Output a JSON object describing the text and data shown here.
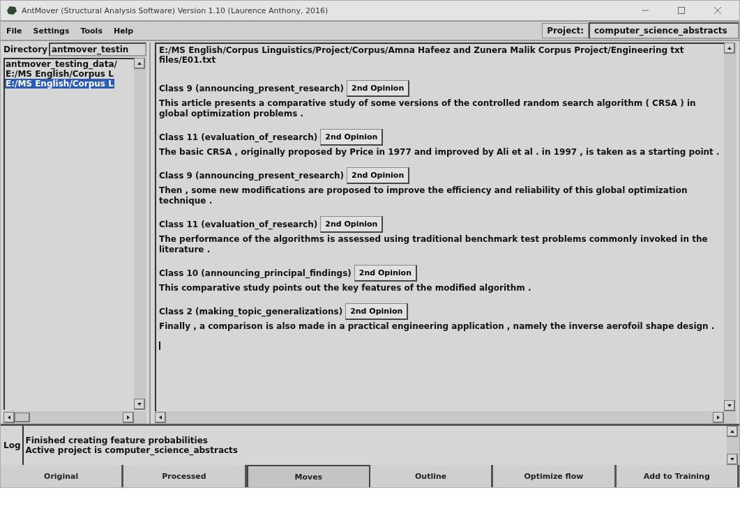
{
  "window": {
    "title": "AntMover (Structural Analysis Software) Version 1.10 (Laurence Anthony, 2016)"
  },
  "menu": [
    "File",
    "Settings",
    "Tools",
    "Help"
  ],
  "project": {
    "label": "Project:",
    "value": "computer_science_abstracts"
  },
  "directory": {
    "label": "Directory",
    "value": "antmover_testin"
  },
  "files": [
    {
      "label": "antmover_testing_data/",
      "selected": false
    },
    {
      "label": "E:/MS English/Corpus L",
      "selected": false
    },
    {
      "label": "E:/MS English/Corpus L",
      "selected": true
    }
  ],
  "document": {
    "path": "E:/MS English/Corpus Linguistics/Project/Corpus/Amna Hafeez and Zunera Malik Corpus Project/Engineering txt files/E01.txt",
    "moves": [
      {
        "class": "Class 9 (announcing_present_research)",
        "button": "2nd Opinion",
        "text": "This article presents a comparative study of some versions of the controlled random search algorithm ( CRSA ) in global optimization problems ."
      },
      {
        "class": "Class 11 (evaluation_of_research)",
        "button": "2nd Opinion",
        "text": "The basic CRSA , originally proposed by Price in 1977 and improved by Ali et al .  in 1997 , is taken as a starting point ."
      },
      {
        "class": "Class 9 (announcing_present_research)",
        "button": "2nd Opinion",
        "text": "Then , some new modifications are proposed to improve the efficiency and reliability of this global optimization technique ."
      },
      {
        "class": "Class 11 (evaluation_of_research)",
        "button": "2nd Opinion",
        "text": "The performance of the algorithms is assessed using traditional benchmark test problems commonly invoked in the literature ."
      },
      {
        "class": "Class 10 (announcing_principal_findings)",
        "button": "2nd Opinion",
        "text": "This comparative study points out the key features of the modified algorithm ."
      },
      {
        "class": "Class 2 (making_topic_generalizations)",
        "button": "2nd Opinion",
        "text": "Finally , a comparison is also made in a practical engineering application , namely the inverse aerofoil shape design ."
      }
    ]
  },
  "log": {
    "label": "Log",
    "lines": [
      "Finished creating feature probabilities",
      "Active project is computer_science_abstracts"
    ]
  },
  "tabs": [
    {
      "label": "Original",
      "selected": false
    },
    {
      "label": "Processed",
      "selected": false
    },
    {
      "label": "Moves",
      "selected": true
    },
    {
      "label": "Outline",
      "selected": false
    },
    {
      "label": "Optimize flow",
      "selected": false
    },
    {
      "label": "Add to Training",
      "selected": false
    }
  ]
}
